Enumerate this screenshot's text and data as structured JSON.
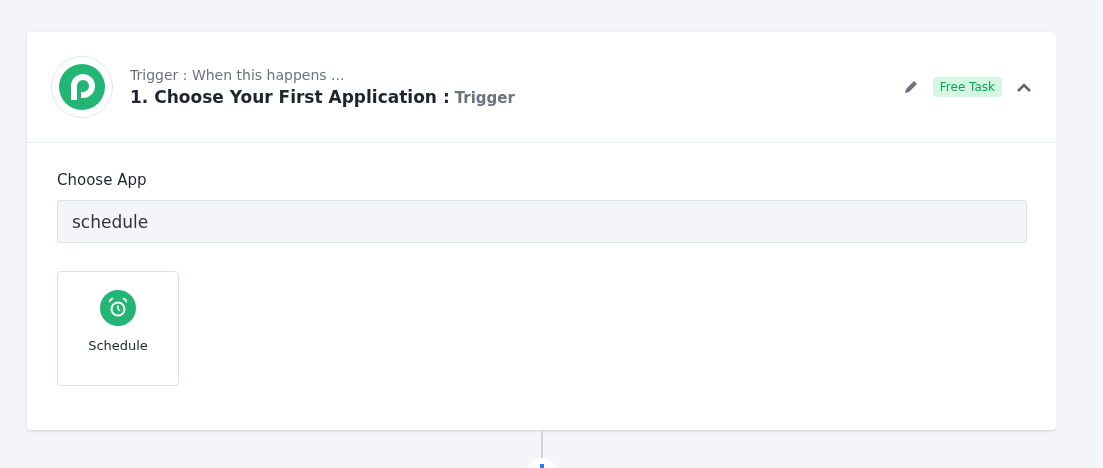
{
  "step": {
    "subtitle": "Trigger : When this happens ...",
    "title": "1. Choose Your First Application :",
    "type_label": "Trigger",
    "badge": "Free Task",
    "expanded": true
  },
  "field": {
    "label": "Choose App",
    "value": "schedule"
  },
  "apps": [
    {
      "name": "Schedule",
      "selected": false
    }
  ]
}
